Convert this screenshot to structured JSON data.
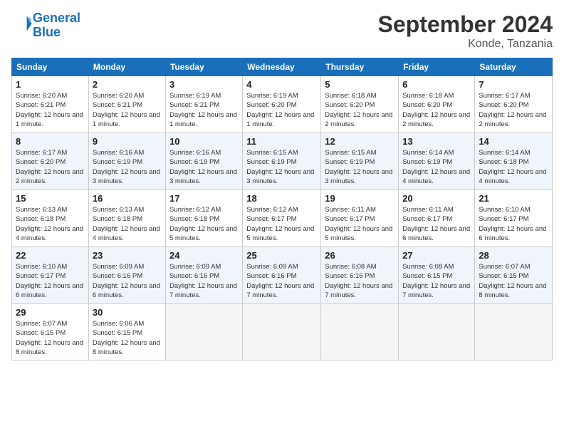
{
  "header": {
    "logo_line1": "General",
    "logo_line2": "Blue",
    "month_year": "September 2024",
    "location": "Konde, Tanzania"
  },
  "days_of_week": [
    "Sunday",
    "Monday",
    "Tuesday",
    "Wednesday",
    "Thursday",
    "Friday",
    "Saturday"
  ],
  "weeks": [
    [
      {
        "day": "1",
        "sunrise": "6:20 AM",
        "sunset": "6:21 PM",
        "daylight": "12 hours and 1 minute."
      },
      {
        "day": "2",
        "sunrise": "6:20 AM",
        "sunset": "6:21 PM",
        "daylight": "12 hours and 1 minute."
      },
      {
        "day": "3",
        "sunrise": "6:19 AM",
        "sunset": "6:21 PM",
        "daylight": "12 hours and 1 minute."
      },
      {
        "day": "4",
        "sunrise": "6:19 AM",
        "sunset": "6:20 PM",
        "daylight": "12 hours and 1 minute."
      },
      {
        "day": "5",
        "sunrise": "6:18 AM",
        "sunset": "6:20 PM",
        "daylight": "12 hours and 2 minutes."
      },
      {
        "day": "6",
        "sunrise": "6:18 AM",
        "sunset": "6:20 PM",
        "daylight": "12 hours and 2 minutes."
      },
      {
        "day": "7",
        "sunrise": "6:17 AM",
        "sunset": "6:20 PM",
        "daylight": "12 hours and 2 minutes."
      }
    ],
    [
      {
        "day": "8",
        "sunrise": "6:17 AM",
        "sunset": "6:20 PM",
        "daylight": "12 hours and 2 minutes."
      },
      {
        "day": "9",
        "sunrise": "6:16 AM",
        "sunset": "6:19 PM",
        "daylight": "12 hours and 3 minutes."
      },
      {
        "day": "10",
        "sunrise": "6:16 AM",
        "sunset": "6:19 PM",
        "daylight": "12 hours and 3 minutes."
      },
      {
        "day": "11",
        "sunrise": "6:15 AM",
        "sunset": "6:19 PM",
        "daylight": "12 hours and 3 minutes."
      },
      {
        "day": "12",
        "sunrise": "6:15 AM",
        "sunset": "6:19 PM",
        "daylight": "12 hours and 3 minutes."
      },
      {
        "day": "13",
        "sunrise": "6:14 AM",
        "sunset": "6:19 PM",
        "daylight": "12 hours and 4 minutes."
      },
      {
        "day": "14",
        "sunrise": "6:14 AM",
        "sunset": "6:18 PM",
        "daylight": "12 hours and 4 minutes."
      }
    ],
    [
      {
        "day": "15",
        "sunrise": "6:13 AM",
        "sunset": "6:18 PM",
        "daylight": "12 hours and 4 minutes."
      },
      {
        "day": "16",
        "sunrise": "6:13 AM",
        "sunset": "6:18 PM",
        "daylight": "12 hours and 4 minutes."
      },
      {
        "day": "17",
        "sunrise": "6:12 AM",
        "sunset": "6:18 PM",
        "daylight": "12 hours and 5 minutes."
      },
      {
        "day": "18",
        "sunrise": "6:12 AM",
        "sunset": "6:17 PM",
        "daylight": "12 hours and 5 minutes."
      },
      {
        "day": "19",
        "sunrise": "6:11 AM",
        "sunset": "6:17 PM",
        "daylight": "12 hours and 5 minutes."
      },
      {
        "day": "20",
        "sunrise": "6:11 AM",
        "sunset": "6:17 PM",
        "daylight": "12 hours and 6 minutes."
      },
      {
        "day": "21",
        "sunrise": "6:10 AM",
        "sunset": "6:17 PM",
        "daylight": "12 hours and 6 minutes."
      }
    ],
    [
      {
        "day": "22",
        "sunrise": "6:10 AM",
        "sunset": "6:17 PM",
        "daylight": "12 hours and 6 minutes."
      },
      {
        "day": "23",
        "sunrise": "6:09 AM",
        "sunset": "6:16 PM",
        "daylight": "12 hours and 6 minutes."
      },
      {
        "day": "24",
        "sunrise": "6:09 AM",
        "sunset": "6:16 PM",
        "daylight": "12 hours and 7 minutes."
      },
      {
        "day": "25",
        "sunrise": "6:09 AM",
        "sunset": "6:16 PM",
        "daylight": "12 hours and 7 minutes."
      },
      {
        "day": "26",
        "sunrise": "6:08 AM",
        "sunset": "6:16 PM",
        "daylight": "12 hours and 7 minutes."
      },
      {
        "day": "27",
        "sunrise": "6:08 AM",
        "sunset": "6:15 PM",
        "daylight": "12 hours and 7 minutes."
      },
      {
        "day": "28",
        "sunrise": "6:07 AM",
        "sunset": "6:15 PM",
        "daylight": "12 hours and 8 minutes."
      }
    ],
    [
      {
        "day": "29",
        "sunrise": "6:07 AM",
        "sunset": "6:15 PM",
        "daylight": "12 hours and 8 minutes."
      },
      {
        "day": "30",
        "sunrise": "6:06 AM",
        "sunset": "6:15 PM",
        "daylight": "12 hours and 8 minutes."
      },
      null,
      null,
      null,
      null,
      null
    ]
  ]
}
